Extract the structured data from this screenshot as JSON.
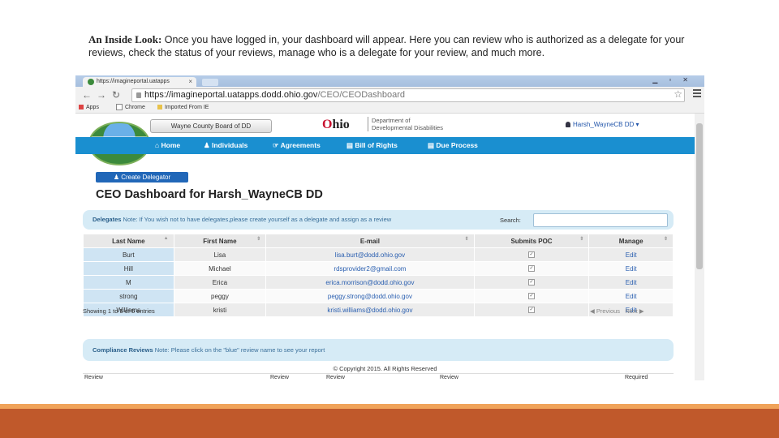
{
  "caption": {
    "lead": "An Inside Look:",
    "text": " Once you have logged in, your dashboard will appear. Here you can review who is authorized as a delegate for your reviews, check the status of your reviews, manage who is a delegate for your review, and much more."
  },
  "browser": {
    "tab_title": "https://imagineportal.uatapps",
    "url_domain": "https://imagineportal.uatapps.dodd.ohio.gov",
    "url_path": "/CEO/CEODashboard",
    "bookmarks": [
      "Apps",
      "Chrome",
      "Imported From IE"
    ]
  },
  "header": {
    "logo_text": "imagine",
    "county_button": "Wayne County Board of DD",
    "ohio_word": "hio",
    "ohio_o": "O",
    "dept_line1": "Department of",
    "dept_line2": "Developmental Disabilities",
    "user": "Harsh_WayneCB DD"
  },
  "nav": {
    "home": "Home",
    "individuals": "Individuals",
    "agreements": "Agreements",
    "bill_of_rights": "Bill of Rights",
    "due_process": "Due Process"
  },
  "main": {
    "create_delegator": "Create Delegator",
    "title": "CEO Dashboard for Harsh_WayneCB DD"
  },
  "delegates": {
    "label": "Delegates",
    "note": " Note: If You wish not to have delegates,please create yourself as a delegate and assign as a review",
    "search_label": "Search:",
    "columns": [
      "Last Name",
      "First Name",
      "E-mail",
      "Submits POC",
      "Manage"
    ],
    "rows": [
      {
        "last": "Burt",
        "first": "Lisa",
        "email": "lisa.burt@dodd.ohio.gov",
        "manage": "Edit"
      },
      {
        "last": "Hill",
        "first": "Michael",
        "email": "rdsprovider2@gmail.com",
        "manage": "Edit"
      },
      {
        "last": "M",
        "first": "Erica",
        "email": "erica.morrison@dodd.ohio.gov",
        "manage": "Edit"
      },
      {
        "last": "strong",
        "first": "peggy",
        "email": "peggy.strong@dodd.ohio.gov",
        "manage": "Edit"
      },
      {
        "last": "Williams",
        "first": "kristi",
        "email": "kristi.williams@dodd.ohio.gov",
        "manage": "Edit"
      }
    ],
    "showing": "Showing 1 to 5 of 5 entries",
    "previous": "Previous",
    "next": "Next"
  },
  "compliance": {
    "label": "Compliance Reviews",
    "note": " Note: Please click on the \"blue\" review name to see your report"
  },
  "footer": {
    "copyright": "© Copyright 2015. All Rights Reserved",
    "col_review": "Review",
    "col_required": "Required"
  }
}
